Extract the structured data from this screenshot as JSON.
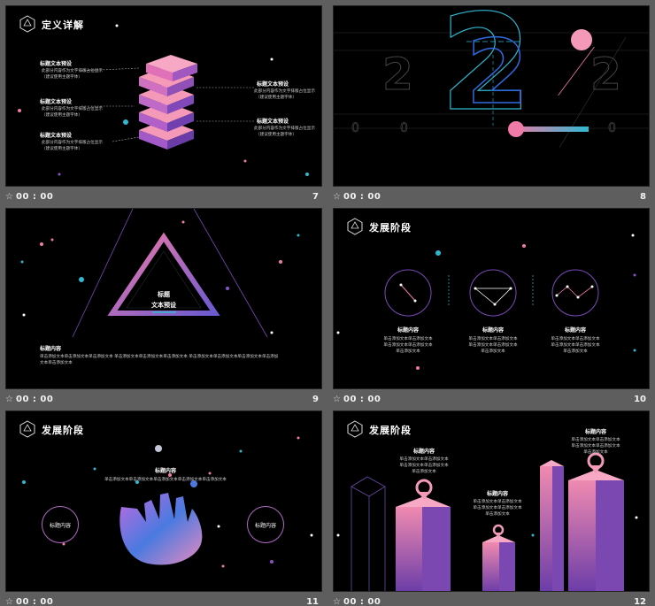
{
  "common": {
    "time": "00 : 00",
    "star": "☆"
  },
  "slides": [
    {
      "num": "7",
      "title": "定义详解",
      "labels": [
        {
          "t": "标题文本预设",
          "b1": "此部分内容作为文字排版占位显示",
          "b2": "（建议使用主题字体）"
        },
        {
          "t": "标题文本预设",
          "b1": "此部分内容作为文字排版占位显示",
          "b2": "（建议使用主题字体）"
        },
        {
          "t": "标题文本预设",
          "b1": "此部分内容作为文字排版占位显示",
          "b2": "（建议使用主题字体）"
        },
        {
          "t": "标题文本预设",
          "b1": "此部分内容作为文字排版占位显示",
          "b2": "（建议使用主题字体）"
        },
        {
          "t": "标题文本预设",
          "b1": "此部分内容作为文字排版占位显示",
          "b2": "（建议使用主题字体）"
        }
      ]
    },
    {
      "num": "8",
      "big": "2",
      "left": "2",
      "right": "2",
      "zeros": [
        "0",
        "0",
        "0"
      ]
    },
    {
      "num": "9",
      "tri_title": "标题",
      "tri_sub": "文本预设",
      "head": "标题内容",
      "body1": "单击添加文本单击添加文本单击添加文本 单击添加文本单击添加文本单击添加文本 单击添加文本单击添加文本单击添加文本单击添加",
      "body2": "文本单击添加文本"
    },
    {
      "num": "10",
      "title": "发展阶段",
      "cols": [
        {
          "t": "标题内容",
          "b1": "单击添加文本单击添加文本",
          "b2": "单击添加文本单击添加文本",
          "b3": "单击添加文本"
        },
        {
          "t": "标题内容",
          "b1": "单击添加文本单击添加文本",
          "b2": "单击添加文本单击添加文本",
          "b3": "单击添加文本"
        },
        {
          "t": "标题内容",
          "b1": "单击添加文本单击添加文本",
          "b2": "单击添加文本单击添加文本",
          "b3": "单击添加文本"
        }
      ]
    },
    {
      "num": "11",
      "title": "发展阶段",
      "head": "标题内容",
      "body": "单击添加文本单击添加文本单击添加文本单击添加文本单击添加文本",
      "left": "标题内容",
      "right": "标题内容"
    },
    {
      "num": "12",
      "title": "发展阶段",
      "items": [
        {
          "t": "标题内容",
          "b1": "单击添加文本单击添加文本",
          "b2": "单击添加文本单击添加文本",
          "b3": "单击添加文本"
        },
        {
          "t": "标题内容",
          "b1": "单击添加文本单击添加文本",
          "b2": "单击添加文本单击添加文本",
          "b3": "单击添加文本"
        },
        {
          "t": "标题内容",
          "b1": "单击添加文本单击添加文本",
          "b2": "单击添加文本单击添加文本",
          "b3": "单击添加文本"
        }
      ]
    }
  ],
  "colors": {
    "pink": "#f07aa8",
    "purple": "#8a52c8",
    "cyan": "#2fb8d0",
    "bg": "#000000",
    "frame": "#5e5e5e"
  }
}
